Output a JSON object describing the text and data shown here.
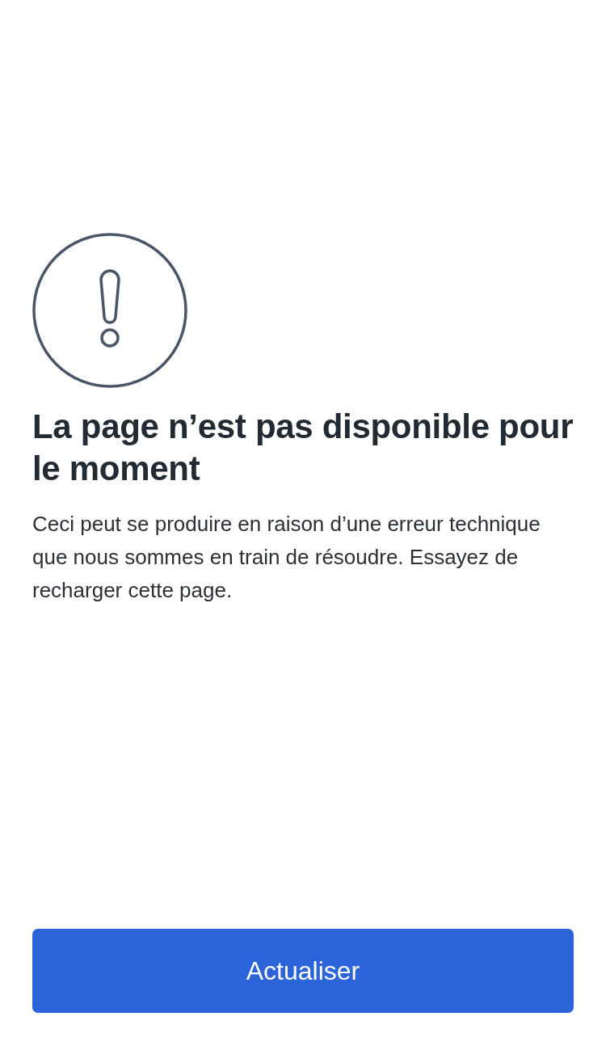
{
  "error": {
    "title": "La page n’est pas disponible pour le moment",
    "message": "Ceci peut se produire en raison d’une erreur technique que nous sommes en train de résoudre. Essayez de recharger cette page."
  },
  "button": {
    "label": "Actualiser"
  }
}
